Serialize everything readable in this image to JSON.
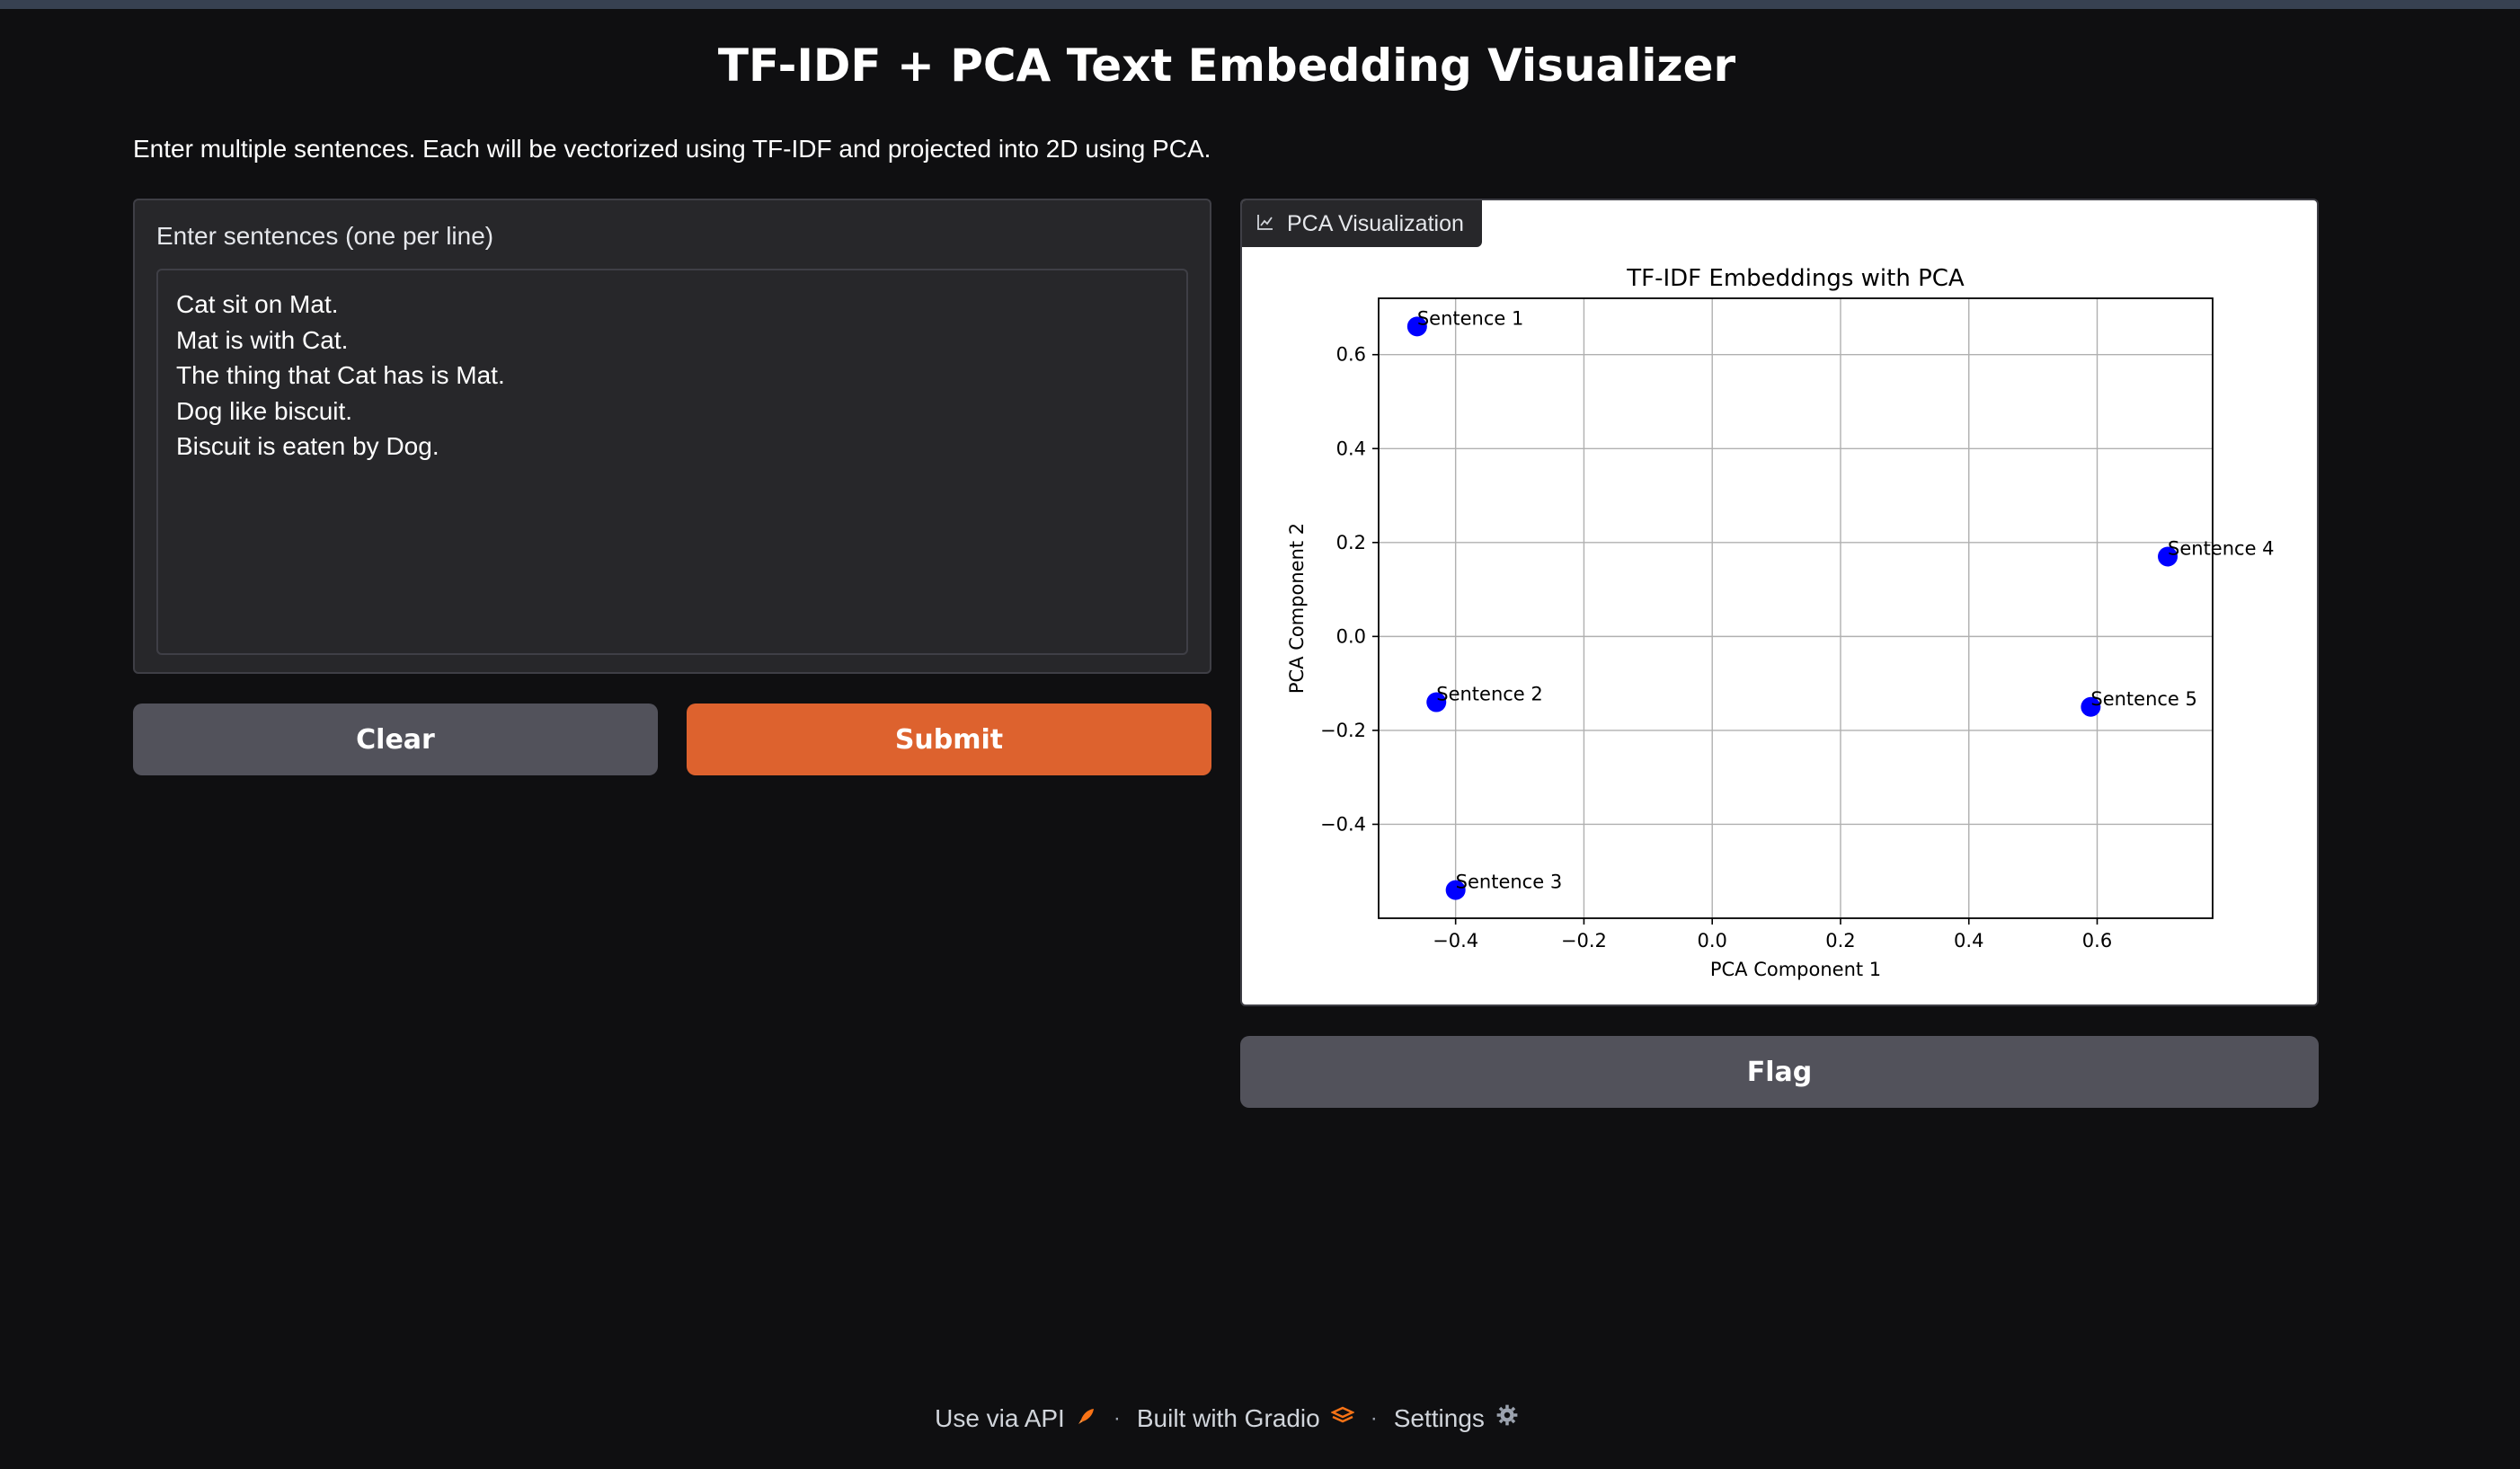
{
  "header": {
    "title": "TF-IDF + PCA Text Embedding Visualizer",
    "description": "Enter multiple sentences. Each will be vectorized using TF-IDF and projected into 2D using PCA."
  },
  "input": {
    "label": "Enter sentences (one per line)",
    "value": "Cat sit on Mat.\nMat is with Cat.\nThe thing that Cat has is Mat.\nDog like biscuit.\nBiscuit is eaten by Dog."
  },
  "buttons": {
    "clear": "Clear",
    "submit": "Submit",
    "flag": "Flag"
  },
  "output": {
    "tag_label": "PCA Visualization",
    "tag_icon": "chart-icon"
  },
  "chart_data": {
    "type": "scatter",
    "title": "TF-IDF Embeddings with PCA",
    "xlabel": "PCA Component 1",
    "ylabel": "PCA Component 2",
    "xlim": [
      -0.52,
      0.78
    ],
    "ylim": [
      -0.6,
      0.72
    ],
    "xticks": [
      -0.4,
      -0.2,
      0.0,
      0.2,
      0.4,
      0.6
    ],
    "xtick_labels": [
      "−0.4",
      "−0.2",
      "0.0",
      "0.2",
      "0.4",
      "0.6"
    ],
    "yticks": [
      -0.4,
      -0.2,
      0.0,
      0.2,
      0.4,
      0.6
    ],
    "ytick_labels": [
      "−0.4",
      "−0.2",
      "0.0",
      "0.2",
      "0.4",
      "0.6"
    ],
    "grid": true,
    "marker_color": "#0000ff",
    "points": [
      {
        "label": "Sentence 1",
        "x": -0.46,
        "y": 0.66
      },
      {
        "label": "Sentence 2",
        "x": -0.43,
        "y": -0.14
      },
      {
        "label": "Sentence 3",
        "x": -0.4,
        "y": -0.54
      },
      {
        "label": "Sentence 4",
        "x": 0.71,
        "y": 0.17
      },
      {
        "label": "Sentence 5",
        "x": 0.59,
        "y": -0.15
      }
    ]
  },
  "footer": {
    "api": "Use via API",
    "built": "Built with Gradio",
    "settings": "Settings"
  }
}
